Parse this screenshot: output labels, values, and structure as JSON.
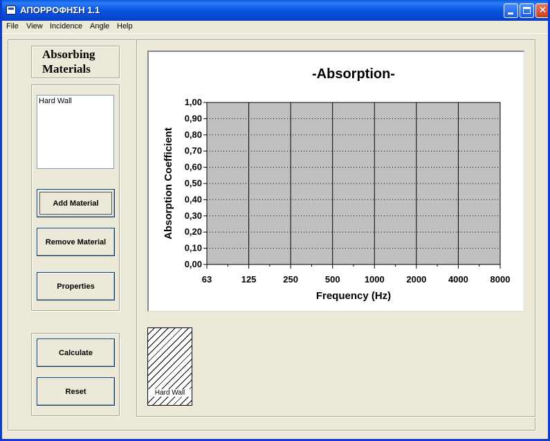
{
  "window": {
    "title": "ΑΠΟΡΡΟΦΗΣΗ 1.1"
  },
  "menu": [
    "File",
    "View",
    "Incidence",
    "Angle",
    "Help"
  ],
  "materials": {
    "heading_line1": "Absorbing",
    "heading_line2": "Materials",
    "list": [
      "Hard Wall"
    ]
  },
  "buttons": {
    "add": "Add Material",
    "remove": "Remove Material",
    "properties": "Properties",
    "calculate": "Calculate",
    "reset": "Reset"
  },
  "layer_preview": {
    "label": "Hard Wall"
  },
  "colors": {
    "plot_bg": "#c0c0c0",
    "title_bar": "#0a55e0"
  },
  "chart_data": {
    "type": "line",
    "title": "-Absorption-",
    "xlabel": "Frequency (Hz)",
    "ylabel": "Absorption Coefficient",
    "x_tick_labels": [
      "63",
      "125",
      "250",
      "500",
      "1000",
      "2000",
      "4000",
      "8000"
    ],
    "y_tick_labels": [
      "0,00",
      "0,10",
      "0,20",
      "0,30",
      "0,40",
      "0,50",
      "0,60",
      "0,70",
      "0,80",
      "0,90",
      "1,00"
    ],
    "ylim": [
      0,
      1
    ],
    "series": [],
    "grid": true
  }
}
